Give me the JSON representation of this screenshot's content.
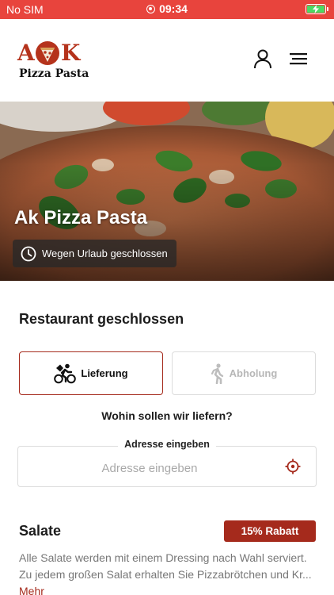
{
  "status_bar": {
    "carrier": "No SIM",
    "time": "09:34"
  },
  "brand": {
    "logo_letters": [
      "A",
      "K"
    ],
    "logo_subtitle": "Pizza Pasta",
    "accent_color": "#a52a1c",
    "status_color": "#e8443d"
  },
  "header": {
    "icons": [
      "user-icon",
      "menu-icon"
    ]
  },
  "hero": {
    "title": "Ak Pizza Pasta",
    "badge_text": "Wegen Urlaub geschlossen",
    "badge_icon": "clock-icon"
  },
  "restaurant_status": "Restaurant geschlossen",
  "order_mode": {
    "options": [
      {
        "label": "Lieferung",
        "icon": "bicycle-icon",
        "selected": true
      },
      {
        "label": "Abholung",
        "icon": "walking-icon",
        "selected": false
      }
    ]
  },
  "delivery": {
    "question": "Wohin sollen wir liefern?",
    "address_label": "Adresse eingeben",
    "address_placeholder": "Adresse eingeben",
    "address_value": ""
  },
  "category": {
    "title": "Salate",
    "badge": "15% Rabatt",
    "description_line1": "Alle Salate werden mit einem Dressing nach Wahl serviert.",
    "description_line2": "Zu jedem großen Salat erhalten Sie Pizzabrötchen und Kr...",
    "more_label": "Mehr"
  }
}
